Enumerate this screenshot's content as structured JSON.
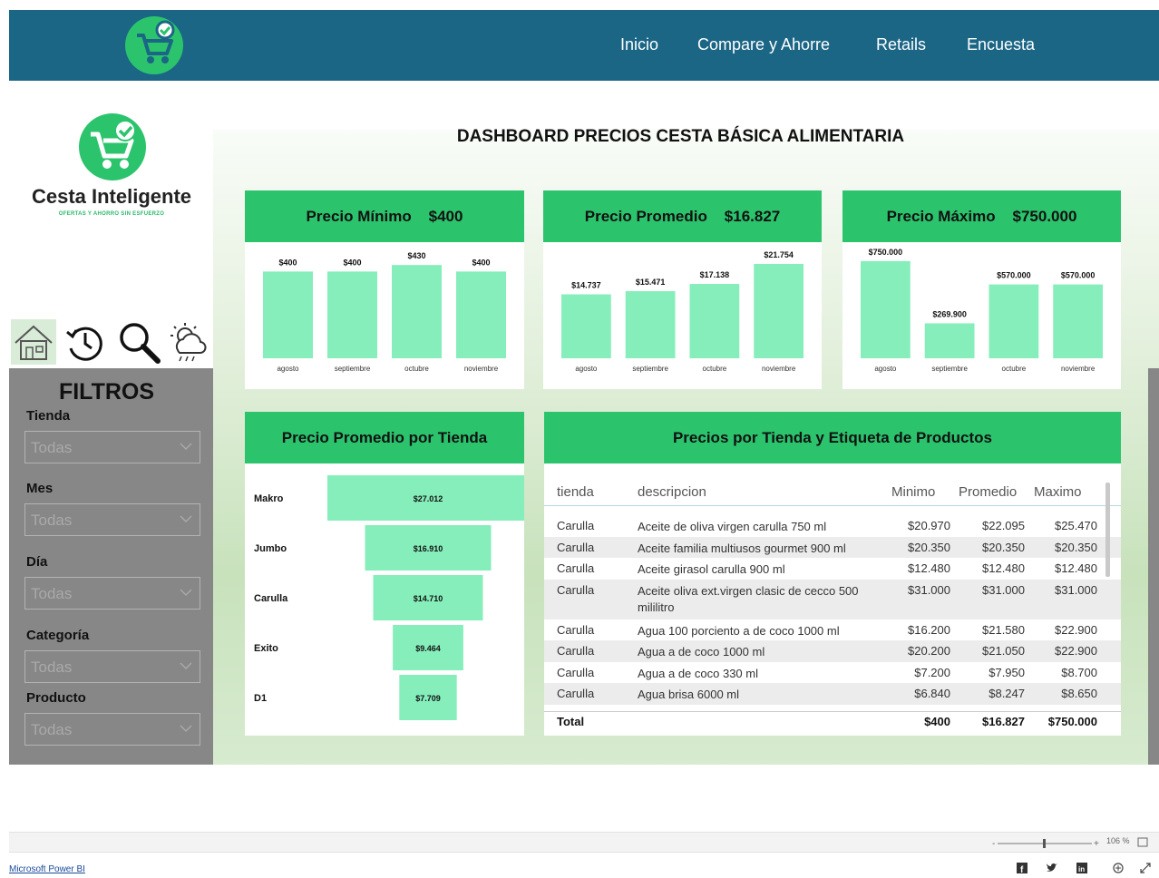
{
  "nav": {
    "items": [
      "Inicio",
      "Compare y Ahorre",
      "Retails",
      "Encuesta"
    ]
  },
  "brand": {
    "name": "Cesta Inteligente",
    "tagline": "OFERTAS Y AHORRO SIN ESFUERZO"
  },
  "sidebar_icons": [
    "home-icon",
    "history-icon",
    "search-icon",
    "weather-icon"
  ],
  "filters": {
    "title": "FILTROS",
    "fields": [
      {
        "label": "Tienda",
        "value": "Todas"
      },
      {
        "label": "Mes",
        "value": "Todas"
      },
      {
        "label": "Día",
        "value": "Todas"
      },
      {
        "label": "Categoría",
        "value": "Todas"
      },
      {
        "label": "Producto",
        "value": "Todas"
      }
    ]
  },
  "dashboard": {
    "title": "DASHBOARD PRECIOS CESTA BÁSICA ALIMENTARIA"
  },
  "kpis": [
    {
      "label": "Precio Mínimo",
      "value": "$400"
    },
    {
      "label": "Precio Promedio",
      "value": "$16.827"
    },
    {
      "label": "Precio Máximo",
      "value": "$750.000"
    }
  ],
  "chart_data": [
    {
      "type": "bar",
      "title": "Precio Mínimo $400",
      "categories": [
        "agosto",
        "septiembre",
        "octubre",
        "noviembre"
      ],
      "values": [
        400,
        400,
        430,
        400
      ],
      "labels": [
        "$400",
        "$400",
        "$430",
        "$400"
      ],
      "ylim": [
        0,
        460
      ]
    },
    {
      "type": "bar",
      "title": "Precio Promedio $16.827",
      "categories": [
        "agosto",
        "septiembre",
        "octubre",
        "noviembre"
      ],
      "values": [
        14737,
        15471,
        17138,
        21754
      ],
      "labels": [
        "$14.737",
        "$15.471",
        "$17.138",
        "$21.754"
      ],
      "ylim": [
        0,
        23000
      ]
    },
    {
      "type": "bar",
      "title": "Precio Máximo $750.000",
      "categories": [
        "agosto",
        "septiembre",
        "octubre",
        "noviembre"
      ],
      "values": [
        750000,
        269900,
        570000,
        570000
      ],
      "labels": [
        "$750.000",
        "$269.900",
        "$570.000",
        "$570.000"
      ],
      "ylim": [
        0,
        770000
      ]
    },
    {
      "type": "bar",
      "orientation": "horizontal-funnel",
      "title": "Precio Promedio por Tienda",
      "categories": [
        "Makro",
        "Jumbo",
        "Carulla",
        "Exito",
        "D1"
      ],
      "values": [
        27012,
        16910,
        14710,
        9464,
        7709
      ],
      "labels": [
        "$27.012",
        "$16.910",
        "$14.710",
        "$9.464",
        "$7.709"
      ]
    }
  ],
  "table": {
    "title": "Precios por Tienda y Etiqueta de Productos",
    "columns": [
      "tienda",
      "descripcion",
      "Minimo",
      "Promedio",
      "Maximo"
    ],
    "rows": [
      [
        "Carulla",
        "Aceite de oliva virgen carulla 750 ml",
        "$20.970",
        "$22.095",
        "$25.470"
      ],
      [
        "Carulla",
        "Aceite familia multiusos gourmet 900 ml",
        "$20.350",
        "$20.350",
        "$20.350"
      ],
      [
        "Carulla",
        "Aceite girasol carulla 900 ml",
        "$12.480",
        "$12.480",
        "$12.480"
      ],
      [
        "Carulla",
        "Aceite oliva ext.virgen clasic de cecco 500 mililitro",
        "$31.000",
        "$31.000",
        "$31.000"
      ],
      [
        "Carulla",
        "Agua 100 porciento a de coco 1000 ml",
        "$16.200",
        "$21.580",
        "$22.900"
      ],
      [
        "Carulla",
        "Agua a de coco 1000 ml",
        "$20.200",
        "$21.050",
        "$22.900"
      ],
      [
        "Carulla",
        "Agua a de coco 330 ml",
        "$7.200",
        "$7.950",
        "$8.700"
      ],
      [
        "Carulla",
        "Agua brisa 6000 ml",
        "$6.840",
        "$8.247",
        "$8.650"
      ]
    ],
    "total": [
      "Total",
      "$400",
      "$16.827",
      "$750.000"
    ]
  },
  "footer": {
    "link": "Microsoft Power BI",
    "zoom": "106 %"
  },
  "colors": {
    "nav_bg": "#1b6585",
    "accent_green": "#2bc46d",
    "bar_green": "#86eebb",
    "filter_bg": "#878787"
  }
}
